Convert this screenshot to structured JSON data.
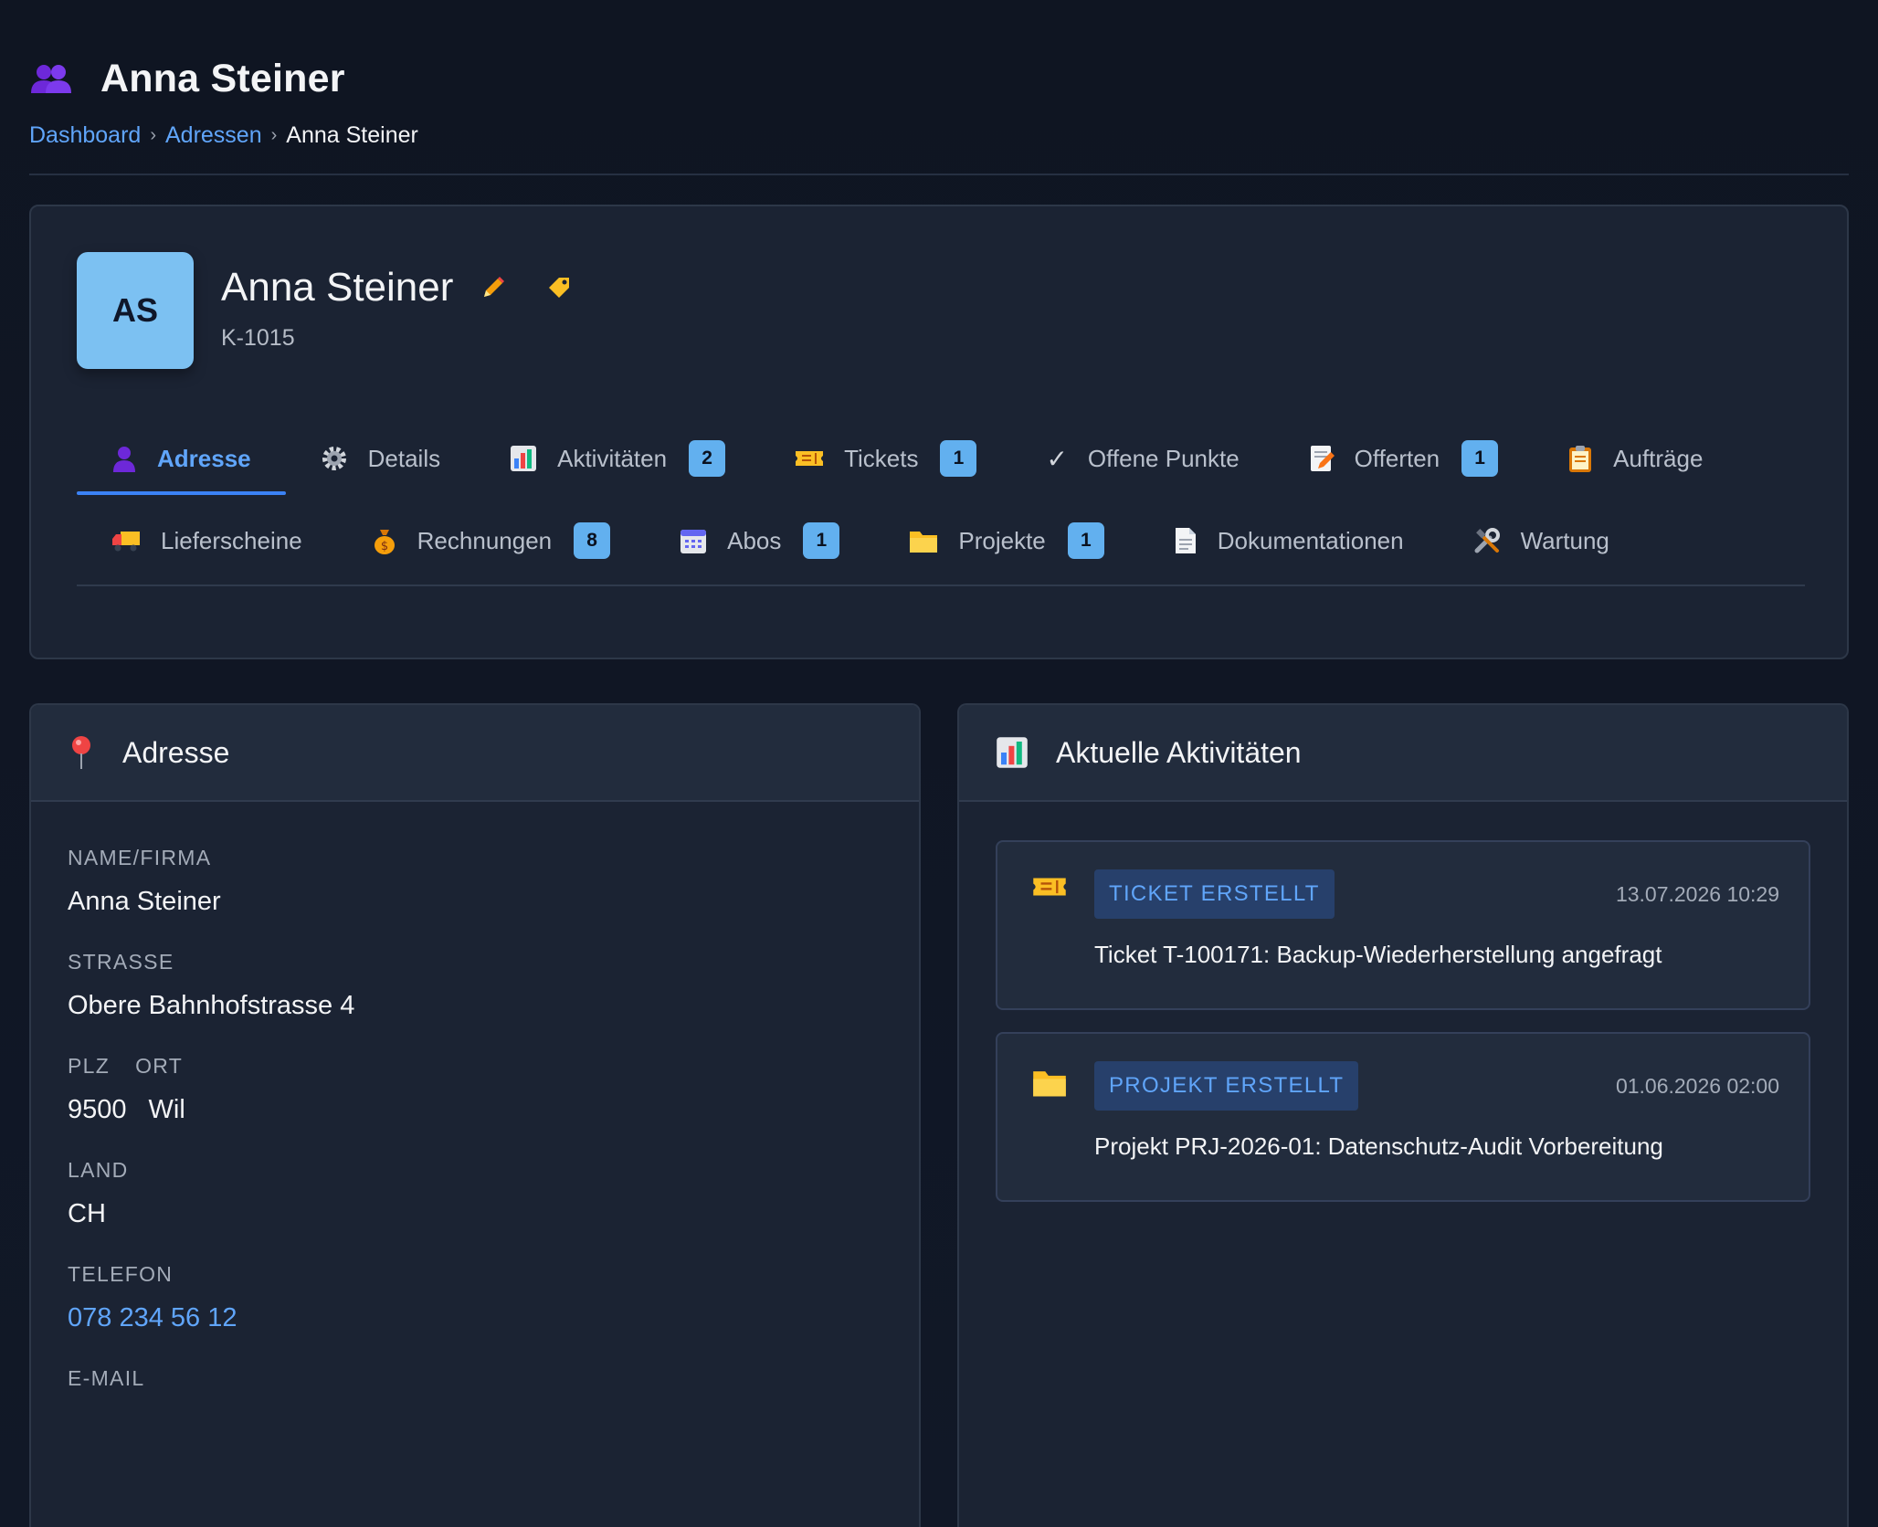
{
  "header": {
    "title": "Anna Steiner",
    "icon": "users-icon",
    "breadcrumb": [
      {
        "label": "Dashboard"
      },
      {
        "label": "Adressen"
      },
      {
        "label": "Anna Steiner"
      }
    ]
  },
  "profile": {
    "initials": "AS",
    "name": "Anna Steiner",
    "customer_no": "K-1015",
    "avatar_color": "#7cc1f2"
  },
  "tabs": [
    {
      "label": "Adresse",
      "icon": "person-icon",
      "active": true
    },
    {
      "label": "Details",
      "icon": "gear-icon"
    },
    {
      "label": "Aktivitäten",
      "icon": "chart-icon",
      "badge": "2"
    },
    {
      "label": "Tickets",
      "icon": "ticket-icon",
      "badge": "1"
    },
    {
      "label": "Offene Punkte",
      "icon": "check-icon"
    },
    {
      "label": "Offerten",
      "icon": "memo-icon",
      "badge": "1"
    },
    {
      "label": "Aufträge",
      "icon": "clipboard-icon"
    },
    {
      "label": "Lieferscheine",
      "icon": "truck-icon"
    },
    {
      "label": "Rechnungen",
      "icon": "money-bag-icon",
      "badge": "8"
    },
    {
      "label": "Abos",
      "icon": "calendar-icon",
      "badge": "1"
    },
    {
      "label": "Projekte",
      "icon": "folder-icon",
      "badge": "1"
    },
    {
      "label": "Dokumentationen",
      "icon": "document-icon"
    },
    {
      "label": "Wartung",
      "icon": "tools-icon"
    }
  ],
  "address_panel": {
    "title": "Adresse",
    "icon": "pin-icon",
    "name_label": "NAME/FIRMA",
    "name_value": "Anna Steiner",
    "street_label": "STRASSE",
    "street_value": "Obere Bahnhofstrasse 4",
    "plz_label": "PLZ",
    "ort_label": "ORT",
    "plz_value": "9500",
    "ort_value": "Wil",
    "country_label": "LAND",
    "country_value": "CH",
    "phone_label": "TELEFON",
    "phone_value": "078 234 56 12",
    "email_label": "E-MAIL"
  },
  "activity_panel": {
    "title": "Aktuelle Aktivitäten",
    "icon": "chart-icon",
    "items": [
      {
        "icon": "ticket-icon",
        "tag": "TICKET ERSTELLT",
        "date": "13.07.2026 10:29",
        "text": "Ticket T-100171: Backup-Wiederherstellung angefragt"
      },
      {
        "icon": "folder-icon",
        "tag": "PROJEKT ERSTELLT",
        "date": "01.06.2026 02:00",
        "text": "Projekt PRJ-2026-01: Datenschutz-Audit Vorbereitung"
      }
    ]
  },
  "colors": {
    "background": "#111827",
    "card": "#1b2333",
    "accent": "#60a5fa",
    "badge": "#62b0ef"
  }
}
